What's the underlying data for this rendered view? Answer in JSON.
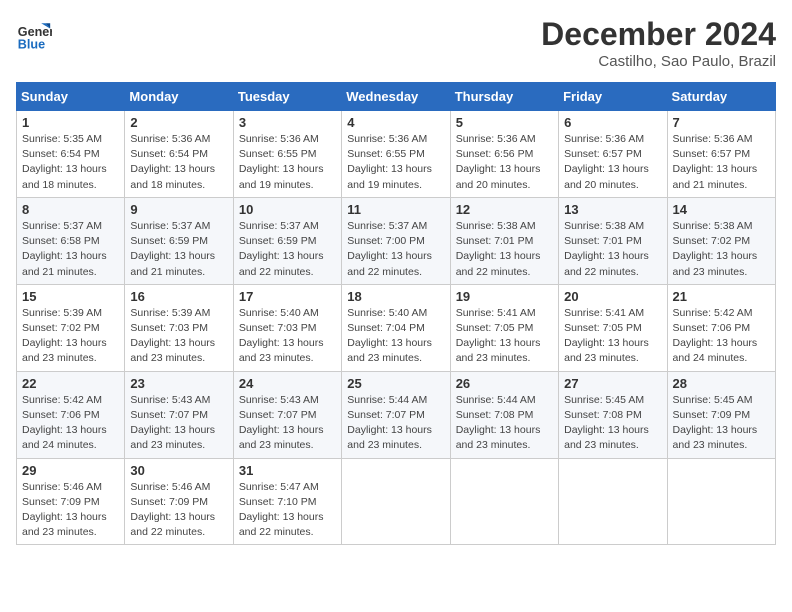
{
  "header": {
    "logo_line1": "General",
    "logo_line2": "Blue",
    "month_year": "December 2024",
    "location": "Castilho, Sao Paulo, Brazil"
  },
  "weekdays": [
    "Sunday",
    "Monday",
    "Tuesday",
    "Wednesday",
    "Thursday",
    "Friday",
    "Saturday"
  ],
  "weeks": [
    [
      {
        "day": "1",
        "info": "Sunrise: 5:35 AM\nSunset: 6:54 PM\nDaylight: 13 hours\nand 18 minutes."
      },
      {
        "day": "2",
        "info": "Sunrise: 5:36 AM\nSunset: 6:54 PM\nDaylight: 13 hours\nand 18 minutes."
      },
      {
        "day": "3",
        "info": "Sunrise: 5:36 AM\nSunset: 6:55 PM\nDaylight: 13 hours\nand 19 minutes."
      },
      {
        "day": "4",
        "info": "Sunrise: 5:36 AM\nSunset: 6:55 PM\nDaylight: 13 hours\nand 19 minutes."
      },
      {
        "day": "5",
        "info": "Sunrise: 5:36 AM\nSunset: 6:56 PM\nDaylight: 13 hours\nand 20 minutes."
      },
      {
        "day": "6",
        "info": "Sunrise: 5:36 AM\nSunset: 6:57 PM\nDaylight: 13 hours\nand 20 minutes."
      },
      {
        "day": "7",
        "info": "Sunrise: 5:36 AM\nSunset: 6:57 PM\nDaylight: 13 hours\nand 21 minutes."
      }
    ],
    [
      {
        "day": "8",
        "info": "Sunrise: 5:37 AM\nSunset: 6:58 PM\nDaylight: 13 hours\nand 21 minutes."
      },
      {
        "day": "9",
        "info": "Sunrise: 5:37 AM\nSunset: 6:59 PM\nDaylight: 13 hours\nand 21 minutes."
      },
      {
        "day": "10",
        "info": "Sunrise: 5:37 AM\nSunset: 6:59 PM\nDaylight: 13 hours\nand 22 minutes."
      },
      {
        "day": "11",
        "info": "Sunrise: 5:37 AM\nSunset: 7:00 PM\nDaylight: 13 hours\nand 22 minutes."
      },
      {
        "day": "12",
        "info": "Sunrise: 5:38 AM\nSunset: 7:01 PM\nDaylight: 13 hours\nand 22 minutes."
      },
      {
        "day": "13",
        "info": "Sunrise: 5:38 AM\nSunset: 7:01 PM\nDaylight: 13 hours\nand 22 minutes."
      },
      {
        "day": "14",
        "info": "Sunrise: 5:38 AM\nSunset: 7:02 PM\nDaylight: 13 hours\nand 23 minutes."
      }
    ],
    [
      {
        "day": "15",
        "info": "Sunrise: 5:39 AM\nSunset: 7:02 PM\nDaylight: 13 hours\nand 23 minutes."
      },
      {
        "day": "16",
        "info": "Sunrise: 5:39 AM\nSunset: 7:03 PM\nDaylight: 13 hours\nand 23 minutes."
      },
      {
        "day": "17",
        "info": "Sunrise: 5:40 AM\nSunset: 7:03 PM\nDaylight: 13 hours\nand 23 minutes."
      },
      {
        "day": "18",
        "info": "Sunrise: 5:40 AM\nSunset: 7:04 PM\nDaylight: 13 hours\nand 23 minutes."
      },
      {
        "day": "19",
        "info": "Sunrise: 5:41 AM\nSunset: 7:05 PM\nDaylight: 13 hours\nand 23 minutes."
      },
      {
        "day": "20",
        "info": "Sunrise: 5:41 AM\nSunset: 7:05 PM\nDaylight: 13 hours\nand 23 minutes."
      },
      {
        "day": "21",
        "info": "Sunrise: 5:42 AM\nSunset: 7:06 PM\nDaylight: 13 hours\nand 24 minutes."
      }
    ],
    [
      {
        "day": "22",
        "info": "Sunrise: 5:42 AM\nSunset: 7:06 PM\nDaylight: 13 hours\nand 24 minutes."
      },
      {
        "day": "23",
        "info": "Sunrise: 5:43 AM\nSunset: 7:07 PM\nDaylight: 13 hours\nand 23 minutes."
      },
      {
        "day": "24",
        "info": "Sunrise: 5:43 AM\nSunset: 7:07 PM\nDaylight: 13 hours\nand 23 minutes."
      },
      {
        "day": "25",
        "info": "Sunrise: 5:44 AM\nSunset: 7:07 PM\nDaylight: 13 hours\nand 23 minutes."
      },
      {
        "day": "26",
        "info": "Sunrise: 5:44 AM\nSunset: 7:08 PM\nDaylight: 13 hours\nand 23 minutes."
      },
      {
        "day": "27",
        "info": "Sunrise: 5:45 AM\nSunset: 7:08 PM\nDaylight: 13 hours\nand 23 minutes."
      },
      {
        "day": "28",
        "info": "Sunrise: 5:45 AM\nSunset: 7:09 PM\nDaylight: 13 hours\nand 23 minutes."
      }
    ],
    [
      {
        "day": "29",
        "info": "Sunrise: 5:46 AM\nSunset: 7:09 PM\nDaylight: 13 hours\nand 23 minutes."
      },
      {
        "day": "30",
        "info": "Sunrise: 5:46 AM\nSunset: 7:09 PM\nDaylight: 13 hours\nand 22 minutes."
      },
      {
        "day": "31",
        "info": "Sunrise: 5:47 AM\nSunset: 7:10 PM\nDaylight: 13 hours\nand 22 minutes."
      },
      {
        "day": "",
        "info": ""
      },
      {
        "day": "",
        "info": ""
      },
      {
        "day": "",
        "info": ""
      },
      {
        "day": "",
        "info": ""
      }
    ]
  ]
}
